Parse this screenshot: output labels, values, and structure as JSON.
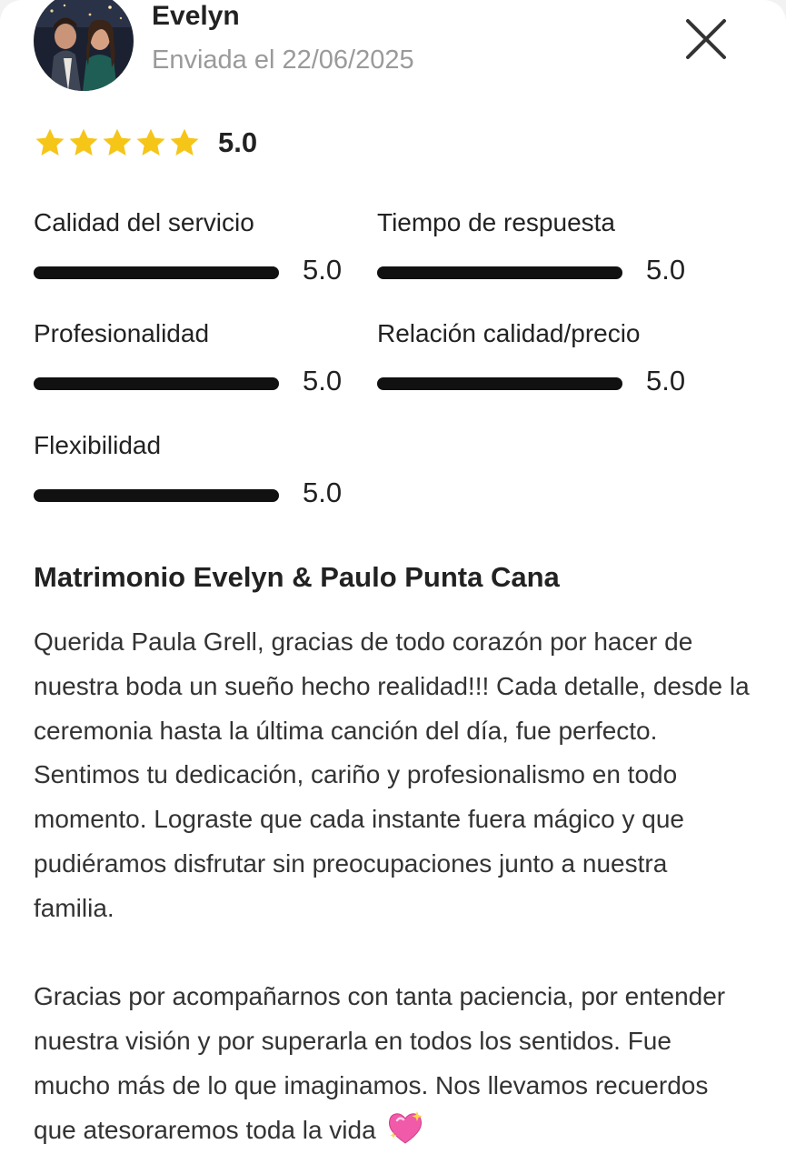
{
  "header": {
    "reviewer_name": "Evelyn",
    "sent_date": "Enviada el 22/06/2025",
    "close_icon": "close-icon",
    "avatar": "couple-photo"
  },
  "rating": {
    "stars": 5,
    "max_stars": 5,
    "star_color": "#f5c518",
    "overall": "5.0"
  },
  "metrics": [
    {
      "label": "Calidad del servicio",
      "value": "5.0",
      "fraction": 1.0
    },
    {
      "label": "Tiempo de respuesta",
      "value": "5.0",
      "fraction": 1.0
    },
    {
      "label": "Profesionalidad",
      "value": "5.0",
      "fraction": 1.0
    },
    {
      "label": "Relación calidad/precio",
      "value": "5.0",
      "fraction": 1.0
    },
    {
      "label": "Flexibilidad",
      "value": "5.0",
      "fraction": 1.0
    }
  ],
  "review": {
    "title": "Matrimonio Evelyn & Paulo Punta Cana",
    "paragraphs": [
      "Querida Paula Grell, gracias de todo corazón por hacer de nuestra boda un sueño hecho realidad!!! Cada detalle, desde la ceremonia hasta la última canción del día, fue perfecto. Sentimos tu dedicación, cariño y profesionalismo en todo momento. Lograste que cada instante fuera mágico y que pudiéramos disfrutar sin preocupaciones junto a nuestra familia.",
      "Gracias por acompañarnos con tanta paciencia, por entender nuestra visión y por superarla en todos los sentidos. Fue mucho más de lo que imaginamos. Nos llevamos recuerdos que atesoraremos toda la vida"
    ],
    "trailing_emoji": "sparkling-heart-icon"
  }
}
